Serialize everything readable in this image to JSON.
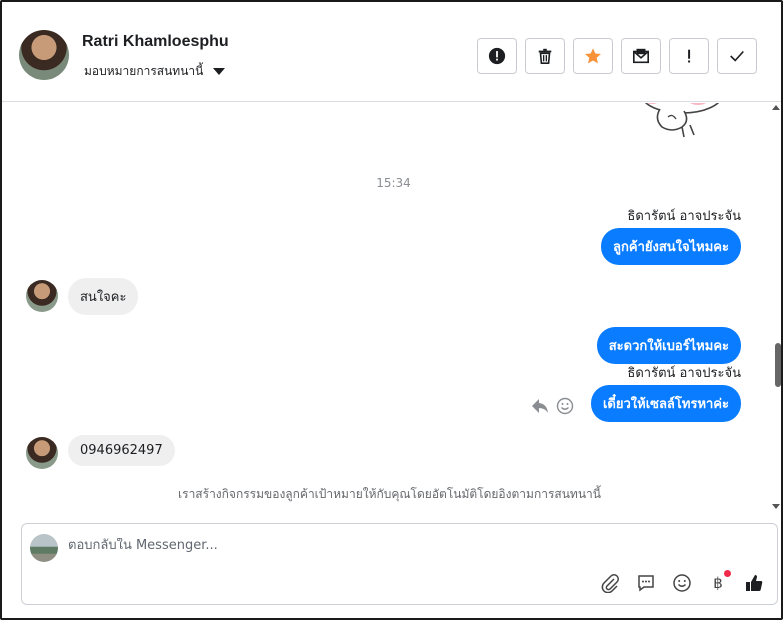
{
  "header": {
    "contact_name": "Ratri Khamloesphu",
    "assign_label": "มอบหมายการสนทนานี้",
    "actions": [
      {
        "name": "report-spam-button",
        "icon": "alert-circle-icon"
      },
      {
        "name": "delete-button",
        "icon": "trash-icon"
      },
      {
        "name": "star-button",
        "icon": "star-icon"
      },
      {
        "name": "mark-unread-button",
        "icon": "envelope-icon"
      },
      {
        "name": "follow-up-button",
        "icon": "exclamation-icon"
      },
      {
        "name": "mark-done-button",
        "icon": "check-icon"
      }
    ],
    "star_color": "#f7923b"
  },
  "chat": {
    "time": "15:34",
    "messages": [
      {
        "direction": "out",
        "sender": "ธิดารัตน์ อาจประจัน",
        "text": "ลูกค้ายังสนใจไหมคะ"
      },
      {
        "direction": "in",
        "text": "สนใจคะ"
      },
      {
        "direction": "out",
        "text": "สะดวกให้เบอร์ไหมคะ"
      },
      {
        "direction": "out",
        "sender": "ธิดารัตน์ อาจประจัน",
        "text": "เดี๋ยวให้เซลล์โทรหาค่ะ"
      },
      {
        "direction": "in",
        "text": "0946962497"
      }
    ],
    "notice": "เราสร้างกิจกรรมของลูกค้าเป้าหมายให้กับคุณโดยอัตโนมัติโดยอิงตามการสนทนานี้"
  },
  "composer": {
    "placeholder": "ตอบกลับใน Messenger...",
    "currency_symbol": "฿",
    "tools": [
      "paperclip-icon",
      "saved-reply-icon",
      "emoji-icon",
      "payment-icon",
      "thumbs-up-icon"
    ]
  },
  "colors": {
    "outgoing_bubble": "#0a7cff",
    "incoming_bubble": "#efeff0",
    "notification_dot": "#f02849"
  }
}
